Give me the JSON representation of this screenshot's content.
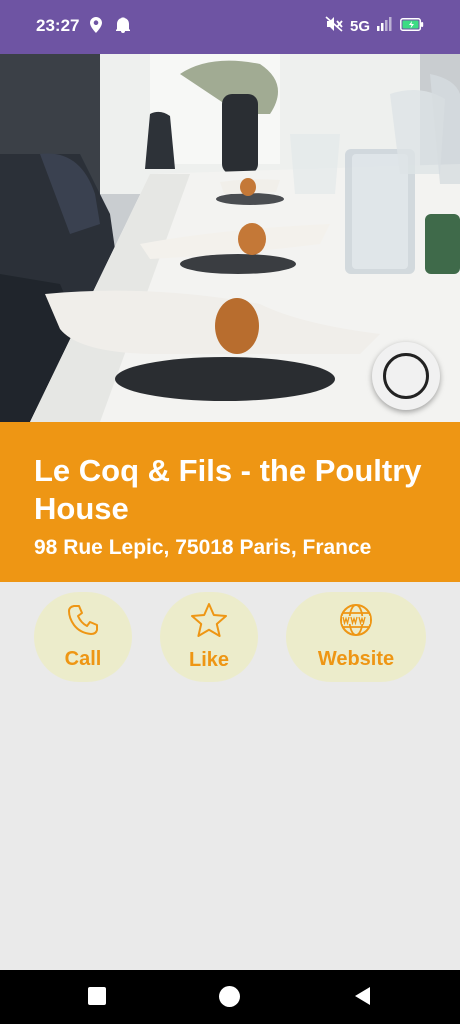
{
  "status_bar": {
    "time": "23:27",
    "network": "5G",
    "icons": [
      "location-icon",
      "notification-bell-icon",
      "mute-icon",
      "signal-icon",
      "battery-charging-icon"
    ]
  },
  "hero": {
    "image": "restaurant-table-setting-photo"
  },
  "restaurant": {
    "name": "Le Coq & Fils - the Poultry House",
    "address": "98 Rue Lepic, 75018 Paris, France"
  },
  "actions": {
    "call": "Call",
    "like": "Like",
    "website": "Website"
  },
  "colors": {
    "status_bar": "#6e54a3",
    "accent": "#ee9614",
    "action_bg": "#ececcb",
    "page_bg": "#eaeaea"
  }
}
